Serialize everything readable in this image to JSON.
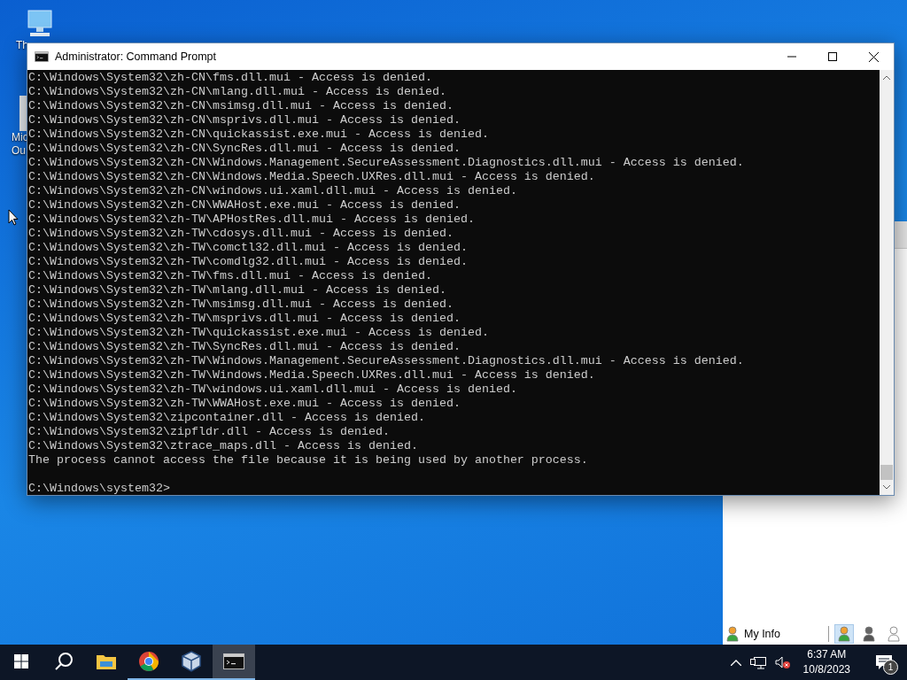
{
  "desktop_icons": [
    {
      "kind": "monitor",
      "lines": [
        "Th"
      ]
    },
    {
      "kind": "document",
      "lines": [
        "Mic",
        "Ou"
      ]
    }
  ],
  "window": {
    "title": "Administrator: Command Prompt",
    "console_lines": [
      "C:\\Windows\\System32\\zh-CN\\fms.dll.mui - Access is denied.",
      "C:\\Windows\\System32\\zh-CN\\mlang.dll.mui - Access is denied.",
      "C:\\Windows\\System32\\zh-CN\\msimsg.dll.mui - Access is denied.",
      "C:\\Windows\\System32\\zh-CN\\msprivs.dll.mui - Access is denied.",
      "C:\\Windows\\System32\\zh-CN\\quickassist.exe.mui - Access is denied.",
      "C:\\Windows\\System32\\zh-CN\\SyncRes.dll.mui - Access is denied.",
      "C:\\Windows\\System32\\zh-CN\\Windows.Management.SecureAssessment.Diagnostics.dll.mui - Access is denied.",
      "C:\\Windows\\System32\\zh-CN\\Windows.Media.Speech.UXRes.dll.mui - Access is denied.",
      "C:\\Windows\\System32\\zh-CN\\windows.ui.xaml.dll.mui - Access is denied.",
      "C:\\Windows\\System32\\zh-CN\\WWAHost.exe.mui - Access is denied.",
      "C:\\Windows\\System32\\zh-TW\\APHostRes.dll.mui - Access is denied.",
      "C:\\Windows\\System32\\zh-TW\\cdosys.dll.mui - Access is denied.",
      "C:\\Windows\\System32\\zh-TW\\comctl32.dll.mui - Access is denied.",
      "C:\\Windows\\System32\\zh-TW\\comdlg32.dll.mui - Access is denied.",
      "C:\\Windows\\System32\\zh-TW\\fms.dll.mui - Access is denied.",
      "C:\\Windows\\System32\\zh-TW\\mlang.dll.mui - Access is denied.",
      "C:\\Windows\\System32\\zh-TW\\msimsg.dll.mui - Access is denied.",
      "C:\\Windows\\System32\\zh-TW\\msprivs.dll.mui - Access is denied.",
      "C:\\Windows\\System32\\zh-TW\\quickassist.exe.mui - Access is denied.",
      "C:\\Windows\\System32\\zh-TW\\SyncRes.dll.mui - Access is denied.",
      "C:\\Windows\\System32\\zh-TW\\Windows.Management.SecureAssessment.Diagnostics.dll.mui - Access is denied.",
      "C:\\Windows\\System32\\zh-TW\\Windows.Media.Speech.UXRes.dll.mui - Access is denied.",
      "C:\\Windows\\System32\\zh-TW\\windows.ui.xaml.dll.mui - Access is denied.",
      "C:\\Windows\\System32\\zh-TW\\WWAHost.exe.mui - Access is denied.",
      "C:\\Windows\\System32\\zipcontainer.dll - Access is denied.",
      "C:\\Windows\\System32\\zipfldr.dll - Access is denied.",
      "C:\\Windows\\System32\\ztrace_maps.dll - Access is denied.",
      "The process cannot access the file because it is being used by another process."
    ],
    "prompt": "C:\\Windows\\system32>"
  },
  "back_panel": {
    "my_info": "My Info",
    "statuses": [
      {
        "kind": "online",
        "selected": true
      },
      {
        "kind": "busy",
        "selected": false
      },
      {
        "kind": "offline",
        "selected": false
      }
    ]
  },
  "taskbar": {
    "apps": [
      {
        "kind": "explorer",
        "running": false,
        "selected": false
      },
      {
        "kind": "chrome",
        "running": true,
        "selected": false
      },
      {
        "kind": "virtualbox",
        "running": true,
        "selected": false
      },
      {
        "kind": "console",
        "running": true,
        "selected": true
      }
    ],
    "time": "6:37 AM",
    "date": "10/8/2023",
    "notification_count": "1"
  }
}
